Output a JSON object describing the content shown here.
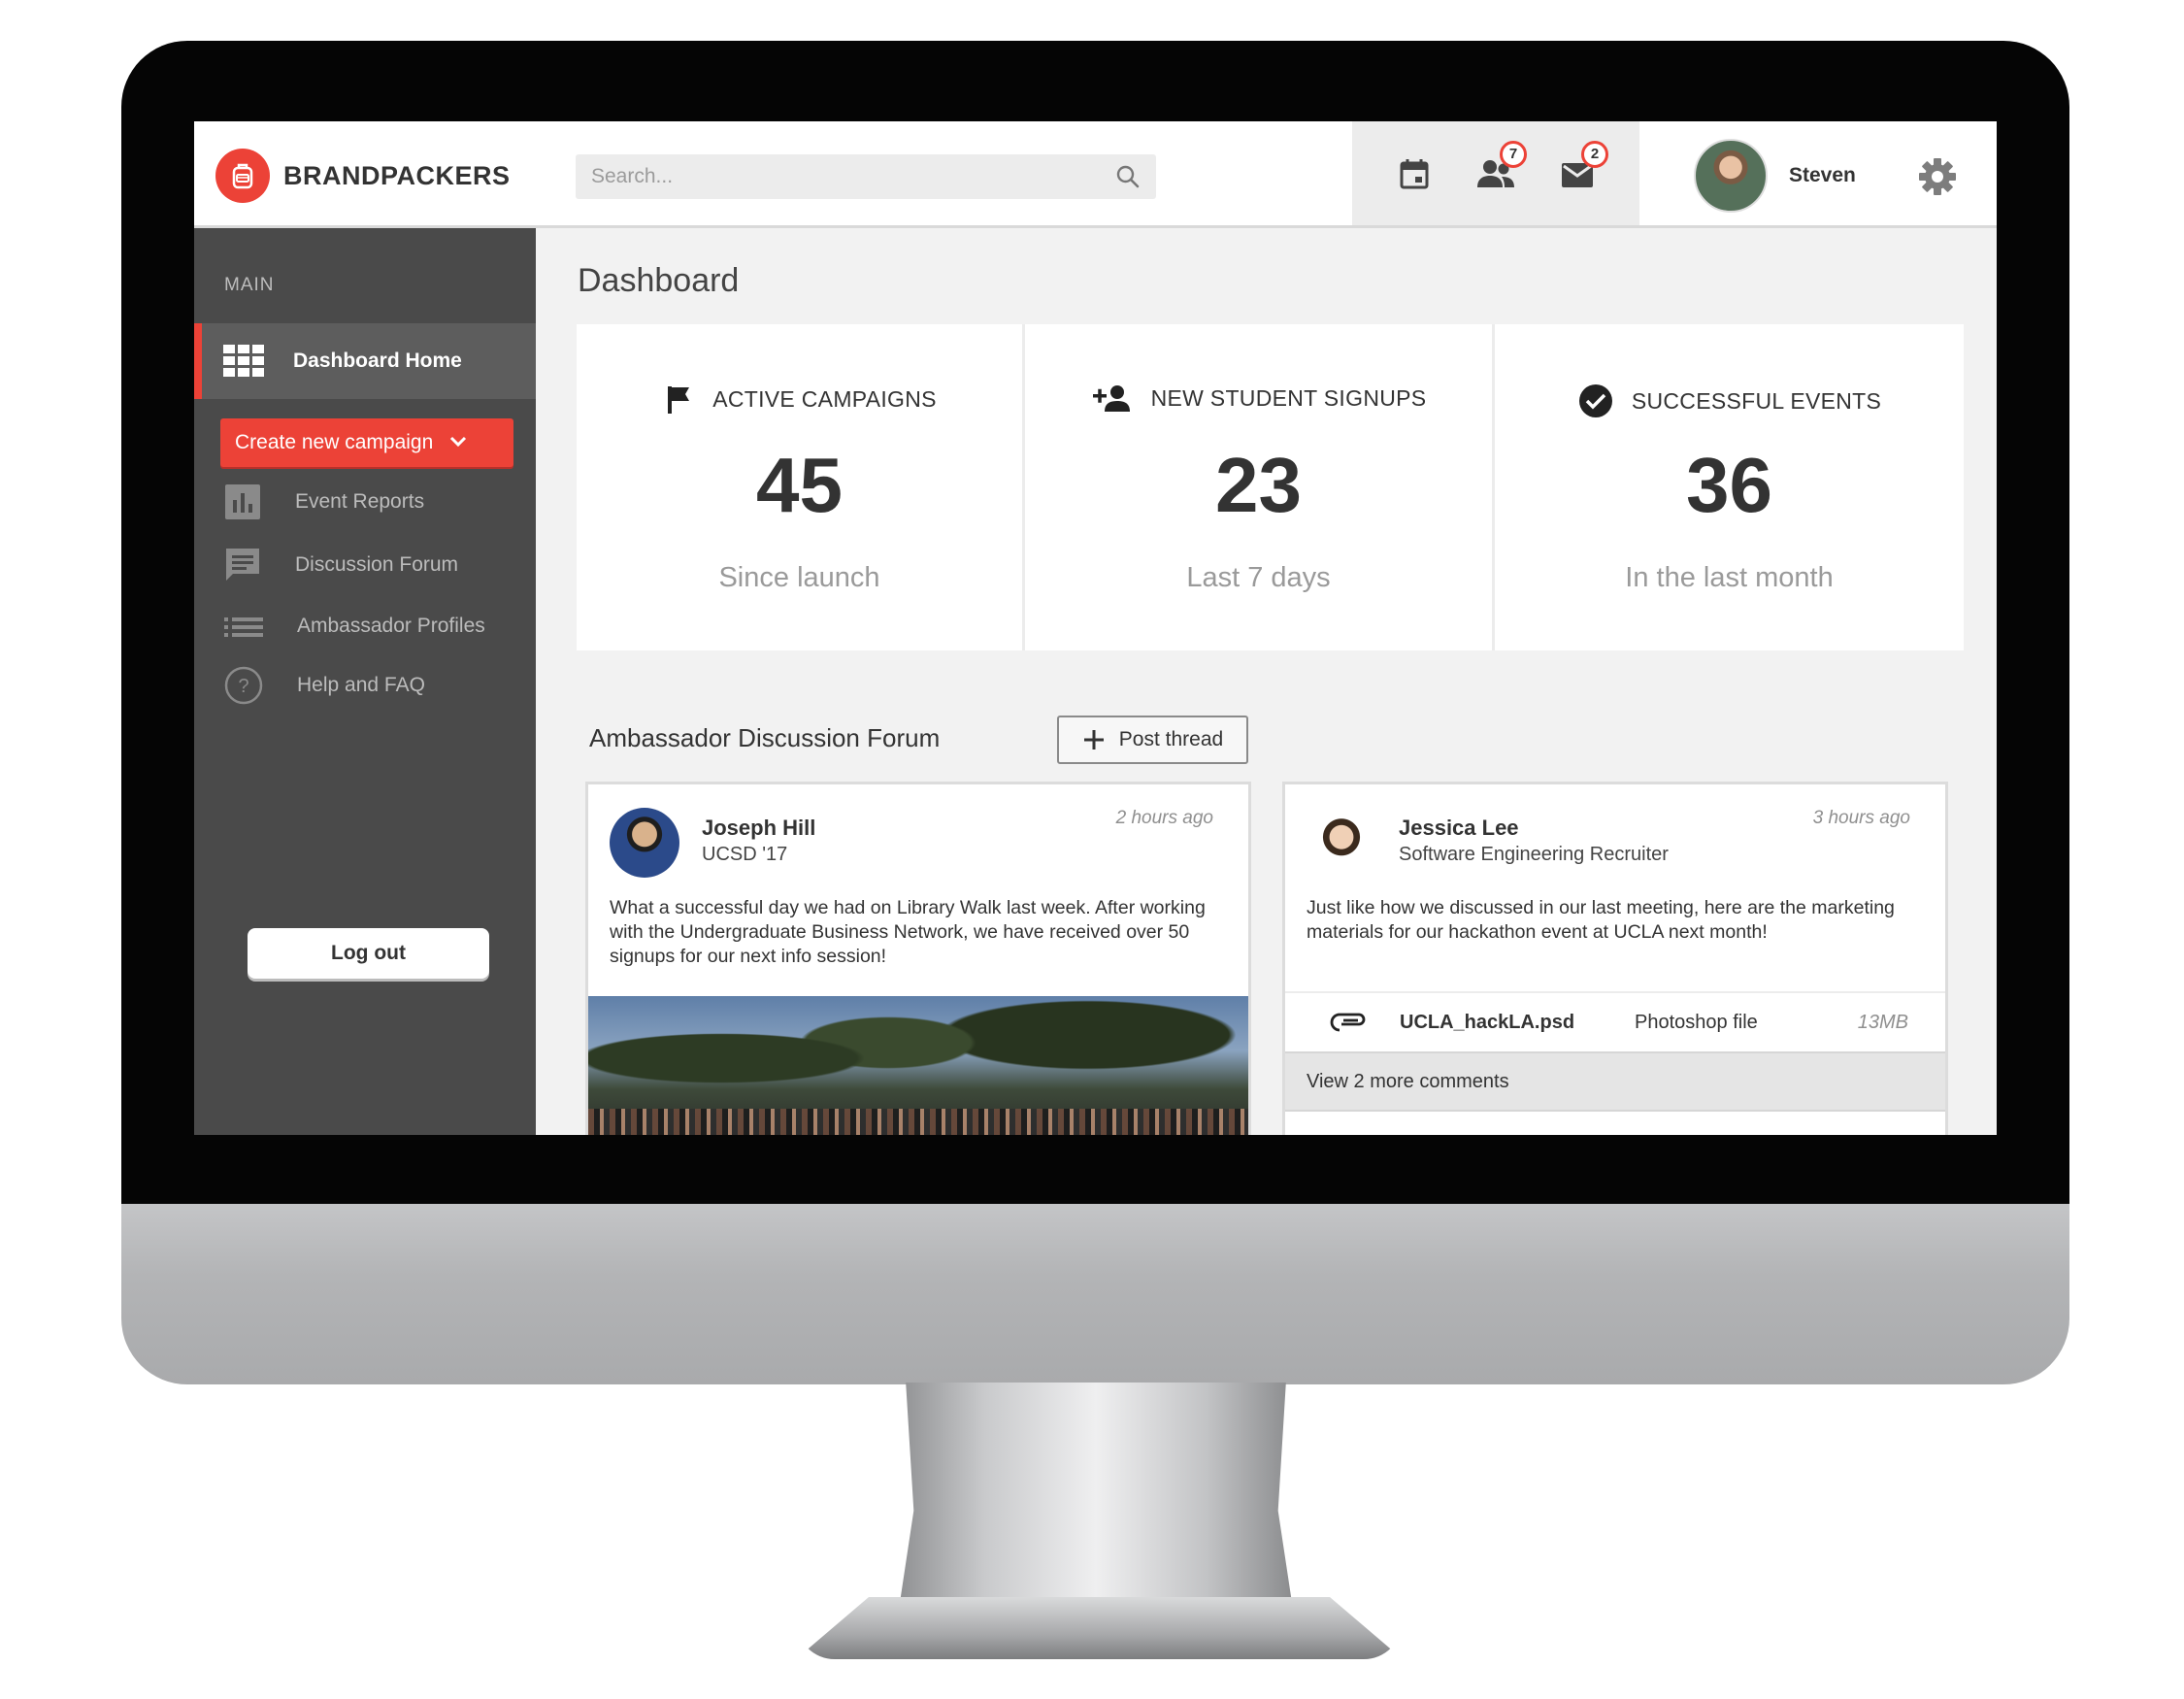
{
  "app": {
    "brand": "BRANDPACKERS"
  },
  "header": {
    "search_placeholder": "Search...",
    "friend_requests_count": "7",
    "messages_count": "2",
    "user_name": "Steven"
  },
  "sidebar": {
    "section_label": "MAIN",
    "active_item": "Dashboard Home",
    "create_button": "Create new campaign",
    "items": [
      {
        "label": "Event Reports",
        "icon": "bar-chart-icon"
      },
      {
        "label": "Discussion Forum",
        "icon": "chat-icon"
      },
      {
        "label": "Ambassador Profiles",
        "icon": "list-icon"
      },
      {
        "label": "Help and FAQ",
        "icon": "help-icon"
      }
    ],
    "logout": "Log out"
  },
  "main": {
    "title": "Dashboard",
    "stats": [
      {
        "label": "ACTIVE CAMPAIGNS",
        "value": "45",
        "sub": "Since launch",
        "icon": "flag-icon"
      },
      {
        "label": "NEW STUDENT SIGNUPS",
        "value": "23",
        "sub": "Last 7 days",
        "icon": "add-person-icon"
      },
      {
        "label": "SUCCESSFUL EVENTS",
        "value": "36",
        "sub": "In the last month",
        "icon": "check-circle-icon"
      }
    ],
    "forum": {
      "title": "Ambassador Discussion Forum",
      "post_button": "Post thread",
      "posts": [
        {
          "author": "Joseph Hill",
          "meta": "UCSD '17",
          "time": "2 hours ago",
          "text": "What a successful day we had on Library Walk last week. After working with the Undergraduate Business Network, we have received over 50 signups for our next info session!"
        },
        {
          "author": "Jessica Lee",
          "meta": "Software Engineering Recruiter",
          "time": "3 hours ago",
          "text": "Just like how we discussed in our last meeting, here are the marketing materials for our hackathon event at UCLA next month!",
          "attachment": {
            "name": "UCLA_hackLA.psd",
            "type": "Photoshop file",
            "size": "13MB"
          },
          "comments_link": "View 2 more comments"
        }
      ]
    }
  },
  "colors": {
    "accent": "#ec4237",
    "sidebar": "#4a4a4a",
    "content_bg": "#f2f2f2"
  }
}
